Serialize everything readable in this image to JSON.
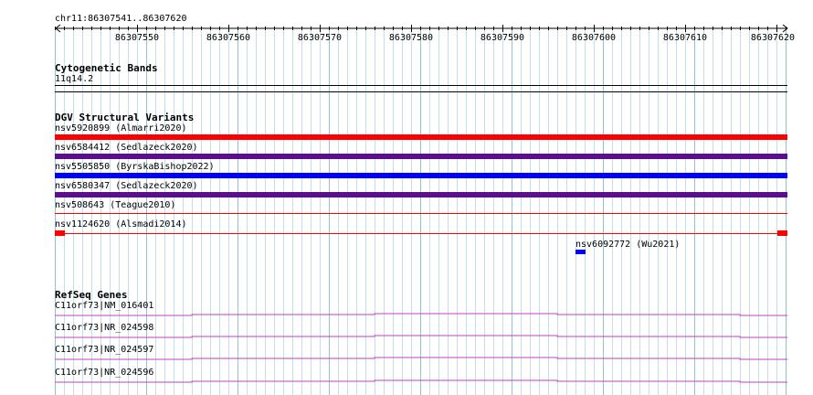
{
  "ruler": {
    "location": "chr11:86307541..86307620",
    "start": 86307541,
    "end": 86307620,
    "ticks": [
      "86307550",
      "86307560",
      "86307570",
      "86307580",
      "86307590",
      "86307600",
      "86307610",
      "86307620"
    ]
  },
  "cytoband": {
    "title": "Cytogenetic Bands",
    "band_label": "11q14.2"
  },
  "dgv": {
    "title": "DGV Structural Variants",
    "features": [
      {
        "label": "nsv5920899 (Almarri2020)",
        "color": "#ff0000",
        "style": "thick"
      },
      {
        "label": "nsv6584412 (Sedlazeck2020)",
        "color": "#5a0f8c",
        "style": "thick"
      },
      {
        "label": "nsv5505850 (ByrskaBishop2022)",
        "color": "#0000ff",
        "style": "thick"
      },
      {
        "label": "nsv6580347 (Sedlazeck2020)",
        "color": "#5a0f8c",
        "style": "thick"
      },
      {
        "label": "nsv508643 (Teague2010)",
        "color": "#ff0000",
        "style": "thin"
      },
      {
        "label": "nsv1124620 (Alsmadi2014)",
        "color": "#ff0000",
        "style": "ends"
      },
      {
        "label": "nsv6092772 (Wu2021)",
        "color": "#0000ff",
        "style": "small"
      }
    ]
  },
  "refseq": {
    "title": "RefSeq Genes",
    "genes": [
      {
        "label": "C11orf73|NM_016401",
        "color": "#c040c0"
      },
      {
        "label": "C11orf73|NR_024598",
        "color": "#c040c0"
      },
      {
        "label": "C11orf73|NR_024597",
        "color": "#c040c0"
      },
      {
        "label": "C11orf73|NR_024596",
        "color": "#c040c0"
      }
    ]
  }
}
